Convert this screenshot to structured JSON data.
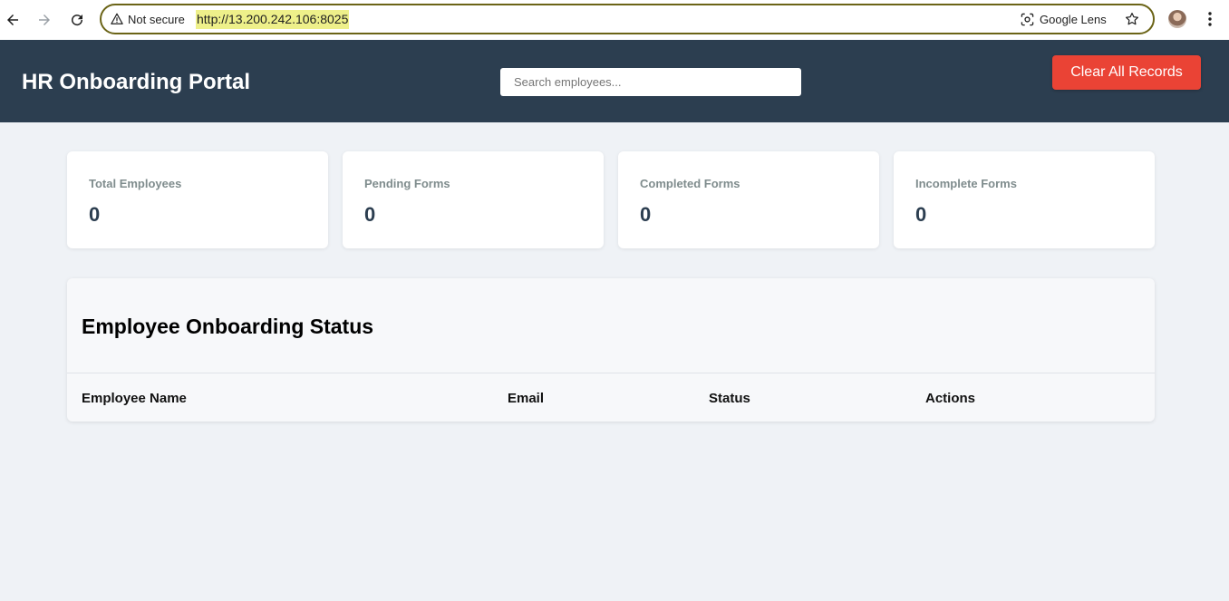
{
  "browser": {
    "security_label": "Not secure",
    "url": "http://13.200.242.106:8025",
    "lens_label": "Google Lens",
    "icons": [
      "back-icon",
      "forward-icon",
      "reload-icon",
      "warning-icon",
      "google-lens-icon",
      "bookmark-star-icon",
      "profile-avatar",
      "more-menu-icon"
    ]
  },
  "header": {
    "title": "HR Onboarding Portal",
    "search_placeholder": "Search employees...",
    "clear_button": "Clear All Records"
  },
  "stats": [
    {
      "label": "Total Employees",
      "value": "0"
    },
    {
      "label": "Pending Forms",
      "value": "0"
    },
    {
      "label": "Completed Forms",
      "value": "0"
    },
    {
      "label": "Incomplete Forms",
      "value": "0"
    }
  ],
  "table": {
    "title": "Employee Onboarding Status",
    "columns": [
      "Employee Name",
      "Email",
      "Status",
      "Actions"
    ],
    "rows": []
  },
  "colors": {
    "header_bg": "#2c3e50",
    "clear_button": "#ea4335",
    "page_bg": "#eff2f6",
    "url_highlight": "#eef08a"
  }
}
